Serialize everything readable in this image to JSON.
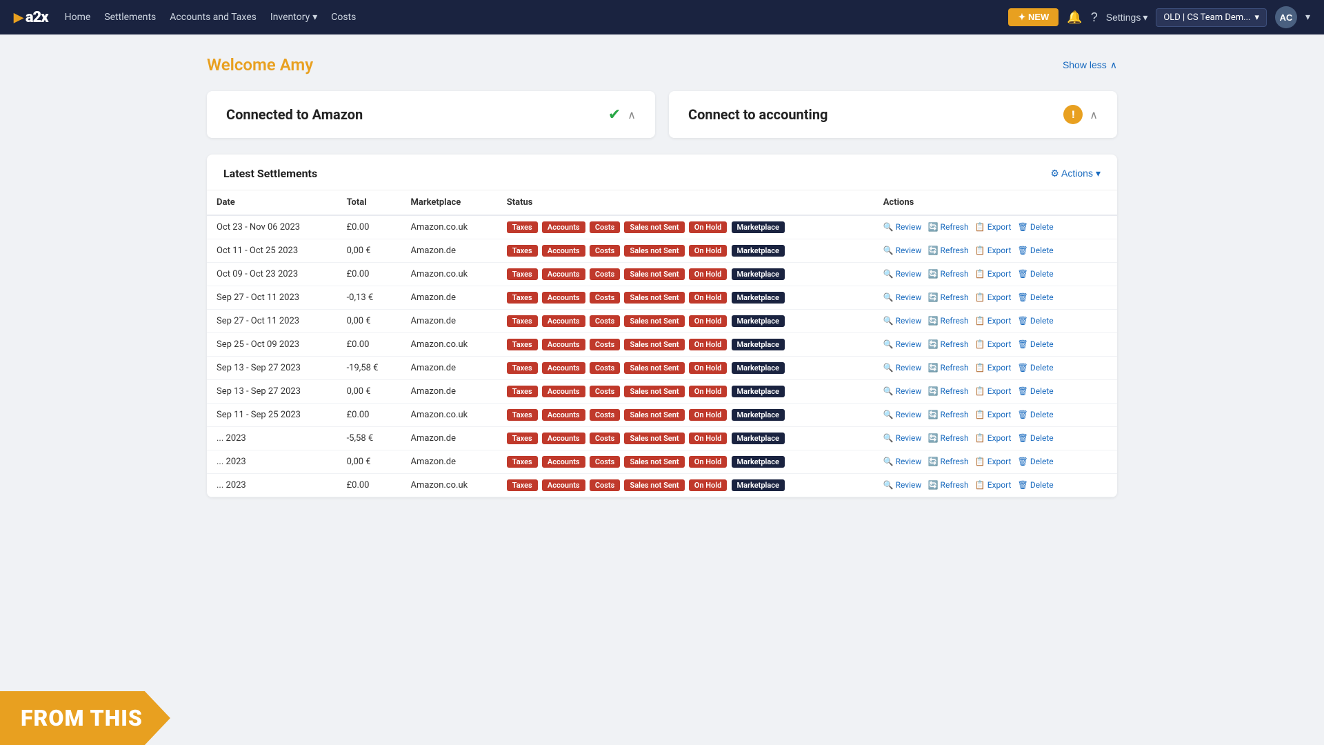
{
  "navbar": {
    "logo_text": "a2x",
    "nav_links": [
      {
        "label": "Home",
        "key": "home"
      },
      {
        "label": "Settlements",
        "key": "settlements"
      },
      {
        "label": "Accounts and Taxes",
        "key": "accounts"
      },
      {
        "label": "Inventory",
        "key": "inventory",
        "dropdown": true
      },
      {
        "label": "Costs",
        "key": "costs"
      }
    ],
    "new_button": "✦ NEW",
    "settings_label": "Settings",
    "account_label": "OLD | CS Team Dem...",
    "avatar_label": "AC"
  },
  "page": {
    "welcome_prefix": "Welcome ",
    "welcome_name": "Amy",
    "show_less": "Show less"
  },
  "amazon_card": {
    "title": "Connected to Amazon"
  },
  "accounting_card": {
    "title": "Connect to accounting"
  },
  "settlements": {
    "title": "Latest Settlements",
    "actions_label": "⚙ Actions",
    "columns": [
      "Date",
      "Total",
      "Marketplace",
      "Status",
      "Actions"
    ],
    "rows": [
      {
        "date": "Oct 23 - Nov 06 2023",
        "total": "£0.00",
        "marketplace": "Amazon.co.uk"
      },
      {
        "date": "Oct 11 - Oct 25 2023",
        "total": "0,00 €",
        "marketplace": "Amazon.de"
      },
      {
        "date": "Oct 09 - Oct 23 2023",
        "total": "£0.00",
        "marketplace": "Amazon.co.uk"
      },
      {
        "date": "Sep 27 - Oct 11 2023",
        "total": "-0,13 €",
        "marketplace": "Amazon.de"
      },
      {
        "date": "Sep 27 - Oct 11 2023",
        "total": "0,00 €",
        "marketplace": "Amazon.de"
      },
      {
        "date": "Sep 25 - Oct 09 2023",
        "total": "£0.00",
        "marketplace": "Amazon.co.uk"
      },
      {
        "date": "Sep 13 - Sep 27 2023",
        "total": "-19,58 €",
        "marketplace": "Amazon.de"
      },
      {
        "date": "Sep 13 - Sep 27 2023",
        "total": "0,00 €",
        "marketplace": "Amazon.de"
      },
      {
        "date": "Sep 11 - Sep 25 2023",
        "total": "£0.00",
        "marketplace": "Amazon.co.uk"
      },
      {
        "date": "... 2023",
        "total": "-5,58 €",
        "marketplace": "Amazon.de"
      },
      {
        "date": "... 2023",
        "total": "0,00 €",
        "marketplace": "Amazon.de"
      },
      {
        "date": "... 2023",
        "total": "£0.00",
        "marketplace": "Amazon.co.uk"
      }
    ],
    "badges": [
      "Taxes",
      "Accounts",
      "Costs",
      "Sales not Sent",
      "On Hold",
      "Marketplace"
    ],
    "action_review": "Review",
    "action_refresh": "Refresh",
    "action_export": "Export",
    "action_delete": "Delete"
  },
  "overlay": {
    "text": "FROM THIS"
  }
}
